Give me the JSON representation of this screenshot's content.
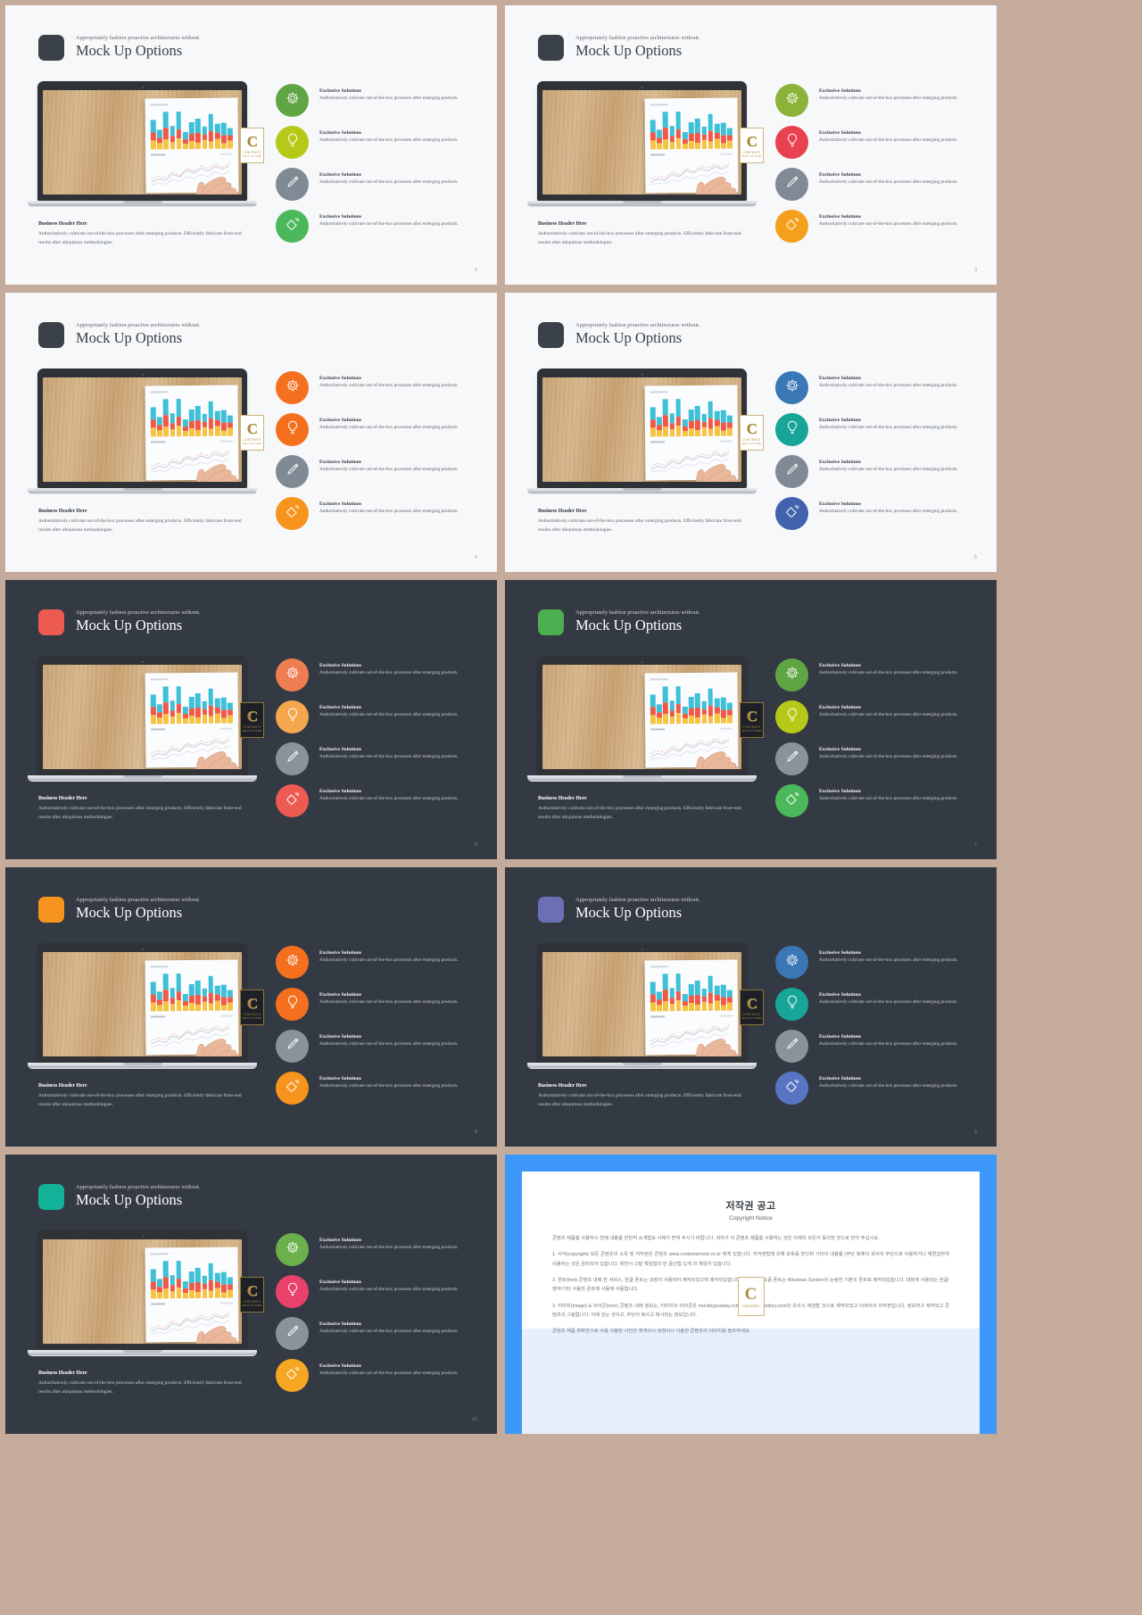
{
  "deck": {
    "background_color": "#c4ab9c",
    "subtitle": "Appropriately fashion proactive architectures without.",
    "title": "Mock Up Options",
    "feature_title": "Exclusive Solutions",
    "feature_desc": "Authoritatively cultivate out-of-the-box processes after emerging products.",
    "business_header": "Business Header Here",
    "business_desc": "Authoritatively cultivate out-of-the-box processes after emerging products. Efficiently fabricate front-end results after ubiquitous methodologies.",
    "logo": {
      "letter": "C",
      "word": "CONTENTS",
      "tagline": "MOCK UP FORM"
    }
  },
  "slides": [
    {
      "page": "2",
      "theme": "light",
      "badge_color": "#3b4149",
      "icons": [
        {
          "name": "gear-icon",
          "color": "#5fa544"
        },
        {
          "name": "lightbulb-icon",
          "color": "#b7c918"
        },
        {
          "name": "pencil-icon",
          "color": "#7f8a94"
        },
        {
          "name": "rocket-icon",
          "color": "#4cb85c"
        }
      ]
    },
    {
      "page": "3",
      "theme": "light",
      "badge_color": "#3b4149",
      "icons": [
        {
          "name": "gear-icon",
          "color": "#8bb33a"
        },
        {
          "name": "lightbulb-icon",
          "color": "#e8414f"
        },
        {
          "name": "pencil-icon",
          "color": "#7f8a94"
        },
        {
          "name": "rocket-icon",
          "color": "#f5a01c"
        }
      ]
    },
    {
      "page": "4",
      "theme": "light",
      "badge_color": "#3b4149",
      "icons": [
        {
          "name": "gear-icon",
          "color": "#f4701f"
        },
        {
          "name": "lightbulb-icon",
          "color": "#f4701f"
        },
        {
          "name": "pencil-icon",
          "color": "#7f8a94"
        },
        {
          "name": "rocket-icon",
          "color": "#f7941d"
        }
      ]
    },
    {
      "page": "5",
      "theme": "light",
      "badge_color": "#3b4149",
      "icons": [
        {
          "name": "gear-icon",
          "color": "#3a77b5"
        },
        {
          "name": "lightbulb-icon",
          "color": "#17a598"
        },
        {
          "name": "pencil-icon",
          "color": "#7f8a94"
        },
        {
          "name": "rocket-icon",
          "color": "#4262ad"
        }
      ]
    },
    {
      "page": "6",
      "theme": "dark",
      "badge_color": "#ec5a52",
      "icons": [
        {
          "name": "gear-icon",
          "color": "#ef7d52"
        },
        {
          "name": "lightbulb-icon",
          "color": "#f5a74e"
        },
        {
          "name": "pencil-icon",
          "color": "#8a939c"
        },
        {
          "name": "rocket-icon",
          "color": "#ec5a52"
        }
      ]
    },
    {
      "page": "7",
      "theme": "dark",
      "badge_color": "#4caf50",
      "icons": [
        {
          "name": "gear-icon",
          "color": "#5fa544"
        },
        {
          "name": "lightbulb-icon",
          "color": "#b7c918"
        },
        {
          "name": "pencil-icon",
          "color": "#8a939c"
        },
        {
          "name": "rocket-icon",
          "color": "#4cb85c"
        }
      ]
    },
    {
      "page": "8",
      "theme": "dark",
      "badge_color": "#f7941d",
      "icons": [
        {
          "name": "gear-icon",
          "color": "#f4701f"
        },
        {
          "name": "lightbulb-icon",
          "color": "#f4701f"
        },
        {
          "name": "pencil-icon",
          "color": "#8a939c"
        },
        {
          "name": "rocket-icon",
          "color": "#f7941d"
        }
      ]
    },
    {
      "page": "9",
      "theme": "dark",
      "badge_color": "#6b6fb5",
      "icons": [
        {
          "name": "gear-icon",
          "color": "#3a77b5"
        },
        {
          "name": "lightbulb-icon",
          "color": "#17a598"
        },
        {
          "name": "pencil-icon",
          "color": "#8a939c"
        },
        {
          "name": "rocket-icon",
          "color": "#5a74c4"
        }
      ]
    },
    {
      "page": "10",
      "theme": "dark",
      "badge_color": "#13b39a",
      "icons": [
        {
          "name": "gear-icon",
          "color": "#6ab04c"
        },
        {
          "name": "lightbulb-icon",
          "color": "#e8416b"
        },
        {
          "name": "pencil-icon",
          "color": "#8a939c"
        },
        {
          "name": "rocket-icon",
          "color": "#f5a623"
        }
      ]
    }
  ],
  "copyright": {
    "accent_color": "#3d97fb",
    "title": "저작권 공고",
    "subtitle": "Copyright Notice",
    "intro": "콘텐츠 제품을 사용하시 전에 내용을 한번씩 소개법요 사제가 받쳐 주시기 바랍니다. 귀하가 이 콘텐츠 제품을 사용하는 것은 아래의 모든이 동의한 것으로 받아 주십시요.",
    "paragraphs": [
      "1. 서식(copyright) 모든 콘텐츠의 소유 및 저작권은 콘텐츠 www.contentsmock.co.kr 에게 있습니다. 저작권법에 의해 보호를 받으며 기타의 내용을 (무단 복제의 회사의 무단으로 이용하거나 재편집하여 이용하는 것은 금지되어 있습니다. 위반시 고발 책임법의 민 중인법 있게 의 책임이 있습니다.",
      "2. 폰트(font) 콘텐츠 내에 한 서비스, 한글 폰트는 내장이 사용되어 제작되었으며 제작되었습니다. 저장 요즘 요즘 폰트는 Windows System의 눈링한 기본의 폰트로 제작되었습니다. 내장에 사용되는 한글/영어/기타 사용한 폰트에 사용에 사용합니다.",
      "3. 이미지(Image) & 아이콘(Icon) 콘텐츠 내에 정보는, 이미지의 아이콘은 mockbyposday.com의 Webbyposltory.com의 유사시 재검할 것으로 제작되었고 이에서의 저작권입니다. 정보하고 제작되고 콘텐츠의 그림합니다. 이에 있는 것이고, 무단이 복사고 복사되는 정보입니다.",
      "콘텐츠 제품 최하반으로 사용 사용된 사진은 에게이시 네정이시 사용한 콘텐츠의 이미지를 참조하세요."
    ]
  }
}
